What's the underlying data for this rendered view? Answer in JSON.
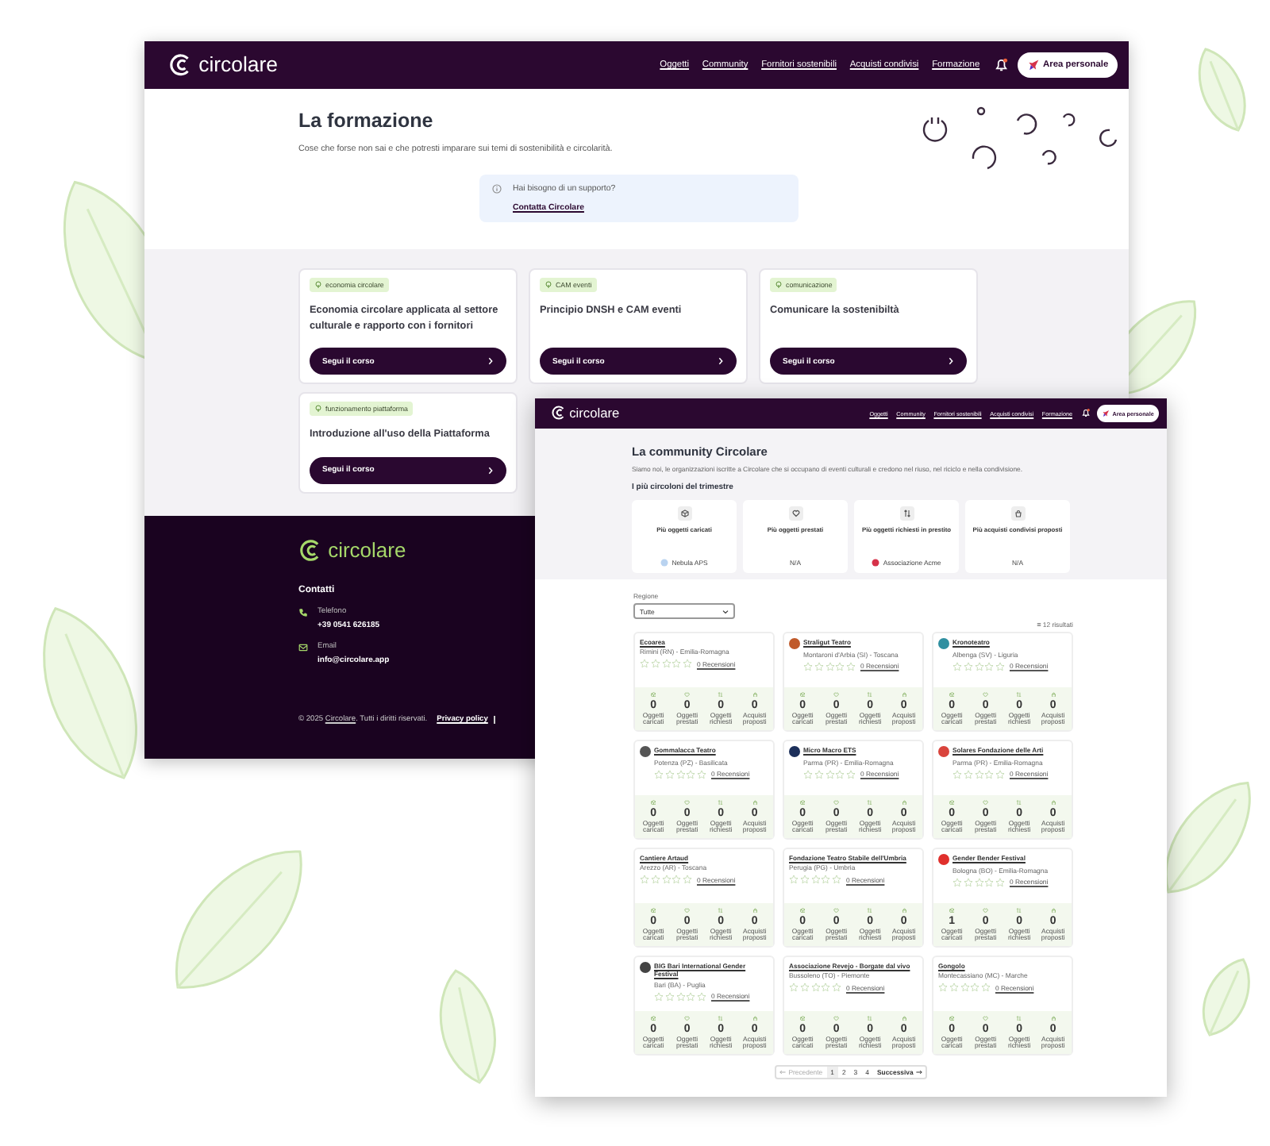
{
  "training_page": {
    "header": {
      "logo": "circolare",
      "nav": [
        "Oggetti",
        "Community",
        "Fornitori sostenibili",
        "Acquisti condivisi",
        "Formazione"
      ],
      "account_button": "Area personale"
    },
    "title": "La formazione",
    "subtitle": "Cose che forse non sai e che potresti imparare sui temi di sostenibilità e circolarità.",
    "support": {
      "question": "Hai bisogno di un supporto?",
      "link": "Contatta Circolare"
    },
    "courses": [
      {
        "tag": "economia circolare",
        "title": "Economia circolare applicata al settore culturale e rapporto con i fornitori",
        "button": "Segui il corso"
      },
      {
        "tag": "CAM eventi",
        "title": "Principio DNSH e CAM eventi",
        "button": "Segui il corso"
      },
      {
        "tag": "comunicazione",
        "title": "Comunicare la sostenibiltà",
        "button": "Segui il corso"
      },
      {
        "tag": "funzionamento piattaforma",
        "title": "Introduzione all'uso della Piattaforma",
        "button": "Segui il corso"
      }
    ],
    "footer": {
      "logo": "circolare",
      "contacts_title": "Contatti",
      "contacts": [
        {
          "kind": "phone",
          "label": "Telefono",
          "value": "+39 0541 626185"
        },
        {
          "kind": "email",
          "label": "Email",
          "value": "info@circolare.app"
        }
      ],
      "copyright": {
        "prefix": "© 2025 ",
        "link": "Circolare",
        "suffix": ". Tutti i diritti riservati."
      },
      "links": [
        "Privacy policy"
      ]
    }
  },
  "community_page": {
    "header": {
      "logo": "circolare",
      "nav": [
        "Oggetti",
        "Community",
        "Fornitori sostenibili",
        "Acquisti condivisi",
        "Formazione"
      ],
      "account_button": "Area personale"
    },
    "title": "La community Circolare",
    "subtitle": "Siamo noi, le organizzazioni iscritte a Circolare che si occupano di eventi culturali e credono nel riuso, nel riciclo e nella condivisione.",
    "top_title": "I più circoloni del trimestre",
    "top": [
      {
        "kind": "loaded",
        "title": "Più oggetti caricati",
        "winner": "Nebula APS",
        "color": "#b9d3f0"
      },
      {
        "kind": "lent",
        "title": "Più oggetti prestati",
        "winner": "N/A"
      },
      {
        "kind": "requested",
        "title": "Più oggetti richiesti in prestito",
        "winner": "Associazione Acme",
        "color": "#d6324a"
      },
      {
        "kind": "proposed",
        "title": "Più acquisti condivisi proposti",
        "winner": "N/A"
      }
    ],
    "filter": {
      "label": "Regione",
      "value": "Tutte"
    },
    "results": "12 risultati",
    "orgs": [
      {
        "name": "Ecoarea",
        "location": "Rimini (RN) - Emilia-Romagna",
        "stars": 0,
        "reviews": "0 Recensioni",
        "stats": [
          {
            "kind": "loaded",
            "value": "0",
            "label": "Oggetti caricati"
          },
          {
            "kind": "lent",
            "value": "0",
            "label": "Oggetti prestati"
          },
          {
            "kind": "requested",
            "value": "0",
            "label": "Oggetti richiesti"
          },
          {
            "kind": "proposed",
            "value": "0",
            "label": "Acquisti proposti"
          }
        ]
      },
      {
        "name": "Straligut Teatro",
        "location": "Montaroni d'Arbia (SI) - Toscana",
        "color": "#c05a2a",
        "stars": 0,
        "reviews": "0 Recensioni",
        "stats": [
          {
            "kind": "loaded",
            "value": "0",
            "label": "Oggetti caricati"
          },
          {
            "kind": "lent",
            "value": "0",
            "label": "Oggetti prestati"
          },
          {
            "kind": "requested",
            "value": "0",
            "label": "Oggetti richiesti"
          },
          {
            "kind": "proposed",
            "value": "0",
            "label": "Acquisti proposti"
          }
        ]
      },
      {
        "name": "Kronoteatro",
        "location": "Albenga (SV) - Liguria",
        "color": "#2f8fa0",
        "stars": 0,
        "reviews": "0 Recensioni",
        "stats": [
          {
            "kind": "loaded",
            "value": "0",
            "label": "Oggetti caricati"
          },
          {
            "kind": "lent",
            "value": "0",
            "label": "Oggetti prestati"
          },
          {
            "kind": "requested",
            "value": "0",
            "label": "Oggetti richiesti"
          },
          {
            "kind": "proposed",
            "value": "0",
            "label": "Acquisti proposti"
          }
        ]
      },
      {
        "name": "Gommalacca Teatro",
        "location": "Potenza (PZ) - Basilicata",
        "color": "#555555",
        "stars": 0,
        "reviews": "0 Recensioni",
        "stats": [
          {
            "kind": "loaded",
            "value": "0",
            "label": "Oggetti caricati"
          },
          {
            "kind": "lent",
            "value": "0",
            "label": "Oggetti prestati"
          },
          {
            "kind": "requested",
            "value": "0",
            "label": "Oggetti richiesti"
          },
          {
            "kind": "proposed",
            "value": "0",
            "label": "Acquisti proposti"
          }
        ]
      },
      {
        "name": "Micro Macro ETS",
        "location": "Parma (PR) - Emilia-Romagna",
        "color": "#1c2f5a",
        "stars": 0,
        "reviews": "0 Recensioni",
        "stats": [
          {
            "kind": "loaded",
            "value": "0",
            "label": "Oggetti caricati"
          },
          {
            "kind": "lent",
            "value": "0",
            "label": "Oggetti prestati"
          },
          {
            "kind": "requested",
            "value": "0",
            "label": "Oggetti richiesti"
          },
          {
            "kind": "proposed",
            "value": "0",
            "label": "Acquisti proposti"
          }
        ]
      },
      {
        "name": "Solares Fondazione delle Arti",
        "location": "Parma (PR) - Emilia-Romagna",
        "color": "#d9443c",
        "stars": 0,
        "reviews": "0 Recensioni",
        "stats": [
          {
            "kind": "loaded",
            "value": "0",
            "label": "Oggetti caricati"
          },
          {
            "kind": "lent",
            "value": "0",
            "label": "Oggetti prestati"
          },
          {
            "kind": "requested",
            "value": "0",
            "label": "Oggetti richiesti"
          },
          {
            "kind": "proposed",
            "value": "0",
            "label": "Acquisti proposti"
          }
        ]
      },
      {
        "name": "Cantiere Artaud",
        "location": "Arezzo (AR) - Toscana",
        "stars": 0,
        "reviews": "0 Recensioni",
        "stats": [
          {
            "kind": "loaded",
            "value": "0",
            "label": "Oggetti caricati"
          },
          {
            "kind": "lent",
            "value": "0",
            "label": "Oggetti prestati"
          },
          {
            "kind": "requested",
            "value": "0",
            "label": "Oggetti richiesti"
          },
          {
            "kind": "proposed",
            "value": "0",
            "label": "Acquisti proposti"
          }
        ]
      },
      {
        "name": "Fondazione Teatro Stabile dell'Umbria",
        "location": "Perugia (PG) - Umbria",
        "stars": 0,
        "reviews": "0 Recensioni",
        "stats": [
          {
            "kind": "loaded",
            "value": "0",
            "label": "Oggetti caricati"
          },
          {
            "kind": "lent",
            "value": "0",
            "label": "Oggetti prestati"
          },
          {
            "kind": "requested",
            "value": "0",
            "label": "Oggetti richiesti"
          },
          {
            "kind": "proposed",
            "value": "0",
            "label": "Acquisti proposti"
          }
        ]
      },
      {
        "name": "Gender Bender Festival",
        "location": "Bologna (BO) - Emilia-Romagna",
        "color": "#e0302c",
        "stars": 0,
        "reviews": "0 Recensioni",
        "stats": [
          {
            "kind": "loaded",
            "value": "1",
            "label": "Oggetti caricati"
          },
          {
            "kind": "lent",
            "value": "0",
            "label": "Oggetti prestati"
          },
          {
            "kind": "requested",
            "value": "0",
            "label": "Oggetti richiesti"
          },
          {
            "kind": "proposed",
            "value": "0",
            "label": "Acquisti proposti"
          }
        ]
      },
      {
        "name": "BIG Bari International Gender Festival",
        "location": "Bari (BA) - Puglia",
        "color": "#444444",
        "stars": 0,
        "reviews": "0 Recensioni",
        "stats": [
          {
            "kind": "loaded",
            "value": "0",
            "label": "Oggetti caricati"
          },
          {
            "kind": "lent",
            "value": "0",
            "label": "Oggetti prestati"
          },
          {
            "kind": "requested",
            "value": "0",
            "label": "Oggetti richiesti"
          },
          {
            "kind": "proposed",
            "value": "0",
            "label": "Acquisti proposti"
          }
        ]
      },
      {
        "name": "Associazione Revejo - Borgate dal vivo",
        "location": "Bussoleno (TO) - Piemonte",
        "stars": 0,
        "reviews": "0 Recensioni",
        "stats": [
          {
            "kind": "loaded",
            "value": "0",
            "label": "Oggetti caricati"
          },
          {
            "kind": "lent",
            "value": "0",
            "label": "Oggetti prestati"
          },
          {
            "kind": "requested",
            "value": "0",
            "label": "Oggetti richiesti"
          },
          {
            "kind": "proposed",
            "value": "0",
            "label": "Acquisti proposti"
          }
        ]
      },
      {
        "name": "Gongolo",
        "location": "Montecassiano (MC) - Marche",
        "stars": 0,
        "reviews": "0 Recensioni",
        "stats": [
          {
            "kind": "loaded",
            "value": "0",
            "label": "Oggetti caricati"
          },
          {
            "kind": "lent",
            "value": "0",
            "label": "Oggetti prestati"
          },
          {
            "kind": "requested",
            "value": "0",
            "label": "Oggetti richiesti"
          },
          {
            "kind": "proposed",
            "value": "0",
            "label": "Acquisti proposti"
          }
        ]
      }
    ],
    "pagination": {
      "prev": {
        "label": "Precedente",
        "disabled": true
      },
      "pages": [
        {
          "label": "1",
          "selected": true
        },
        {
          "label": "2",
          "selected": false
        },
        {
          "label": "3",
          "selected": false
        },
        {
          "label": "4",
          "selected": false
        }
      ],
      "next": {
        "label": "Successiva",
        "disabled": false
      }
    }
  }
}
